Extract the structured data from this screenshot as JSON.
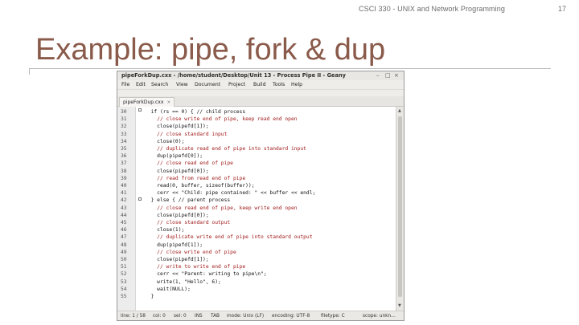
{
  "slide": {
    "course": "CSCI 330 - UNIX and Network Programming",
    "number": "17",
    "title": "Example: pipe, fork & dup"
  },
  "window": {
    "title": "pipeForkDup.cxx - /home/student/Desktop/Unit 13 - Process Pipe II - Geany",
    "controls": [
      "–",
      "□",
      "×"
    ],
    "menu": [
      "File",
      "Edit",
      "Search",
      "View",
      "Document",
      "Project",
      "Build",
      "Tools",
      "Help"
    ],
    "tab": "pipeForkDup.cxx",
    "tab_close": "×"
  },
  "code_lines": [
    {
      "n": "30",
      "text": "  if (rs == 0) { // child process"
    },
    {
      "n": "31",
      "text": "    // close write end of pipe, keep read end open",
      "kind": "comment"
    },
    {
      "n": "32",
      "text": "    close(pipefd[1]);"
    },
    {
      "n": "33",
      "text": "    // close standard input",
      "kind": "comment"
    },
    {
      "n": "34",
      "text": "    close(0);"
    },
    {
      "n": "35",
      "text": "    // duplicate read end of pipe into standard input",
      "kind": "comment"
    },
    {
      "n": "36",
      "text": "    dup(pipefd[0]);"
    },
    {
      "n": "37",
      "text": "    // close read end of pipe",
      "kind": "comment"
    },
    {
      "n": "38",
      "text": "    close(pipefd[0]);"
    },
    {
      "n": "39",
      "text": "    // read from read end of pipe",
      "kind": "comment"
    },
    {
      "n": "40",
      "text": "    read(0, buffer, sizeof(buffer));"
    },
    {
      "n": "41",
      "text": "    cerr << \"Child: pipe contained: \" << buffer << endl;"
    },
    {
      "n": "42",
      "text": "  } else { // parent process"
    },
    {
      "n": "43",
      "text": "    // close read end of pipe, keep write end open",
      "kind": "comment"
    },
    {
      "n": "44",
      "text": "    close(pipefd[0]);"
    },
    {
      "n": "45",
      "text": "    // close standard output",
      "kind": "comment"
    },
    {
      "n": "46",
      "text": "    close(1);"
    },
    {
      "n": "47",
      "text": "    // duplicate write end of pipe into standard output",
      "kind": "comment"
    },
    {
      "n": "48",
      "text": "    dup(pipefd[1]);"
    },
    {
      "n": "49",
      "text": "    // close write end of pipe",
      "kind": "comment"
    },
    {
      "n": "50",
      "text": "    close(pipefd[1]);"
    },
    {
      "n": "51",
      "text": "    // write to write end of pipe",
      "kind": "comment"
    },
    {
      "n": "52",
      "text": "    cerr << \"Parent: writing to pipe\\n\";"
    },
    {
      "n": "53",
      "text": "    write(1, \"Hello\", 6);"
    },
    {
      "n": "54",
      "text": "    wait(NULL);"
    },
    {
      "n": "55",
      "text": "  }"
    }
  ],
  "status": {
    "line": "line: 1 / 58",
    "col": "col: 0",
    "sel": "sel: 0",
    "ins": "INS",
    "tab": "TAB",
    "mode": "mode: Unix (LF)",
    "encoding": "encoding: UTF-8",
    "filetype": "filetype: C",
    "scope": "scope: unkn..."
  },
  "colors": {
    "title": "#8a5a4a",
    "comment": "#a11a1a",
    "string": "#1a1aa8"
  },
  "icons": [
    "window-minimize-icon",
    "window-maximize-icon",
    "window-close-icon",
    "tab-close-icon",
    "fold-marker-icon",
    "scroll-up-icon",
    "scroll-down-icon"
  ]
}
